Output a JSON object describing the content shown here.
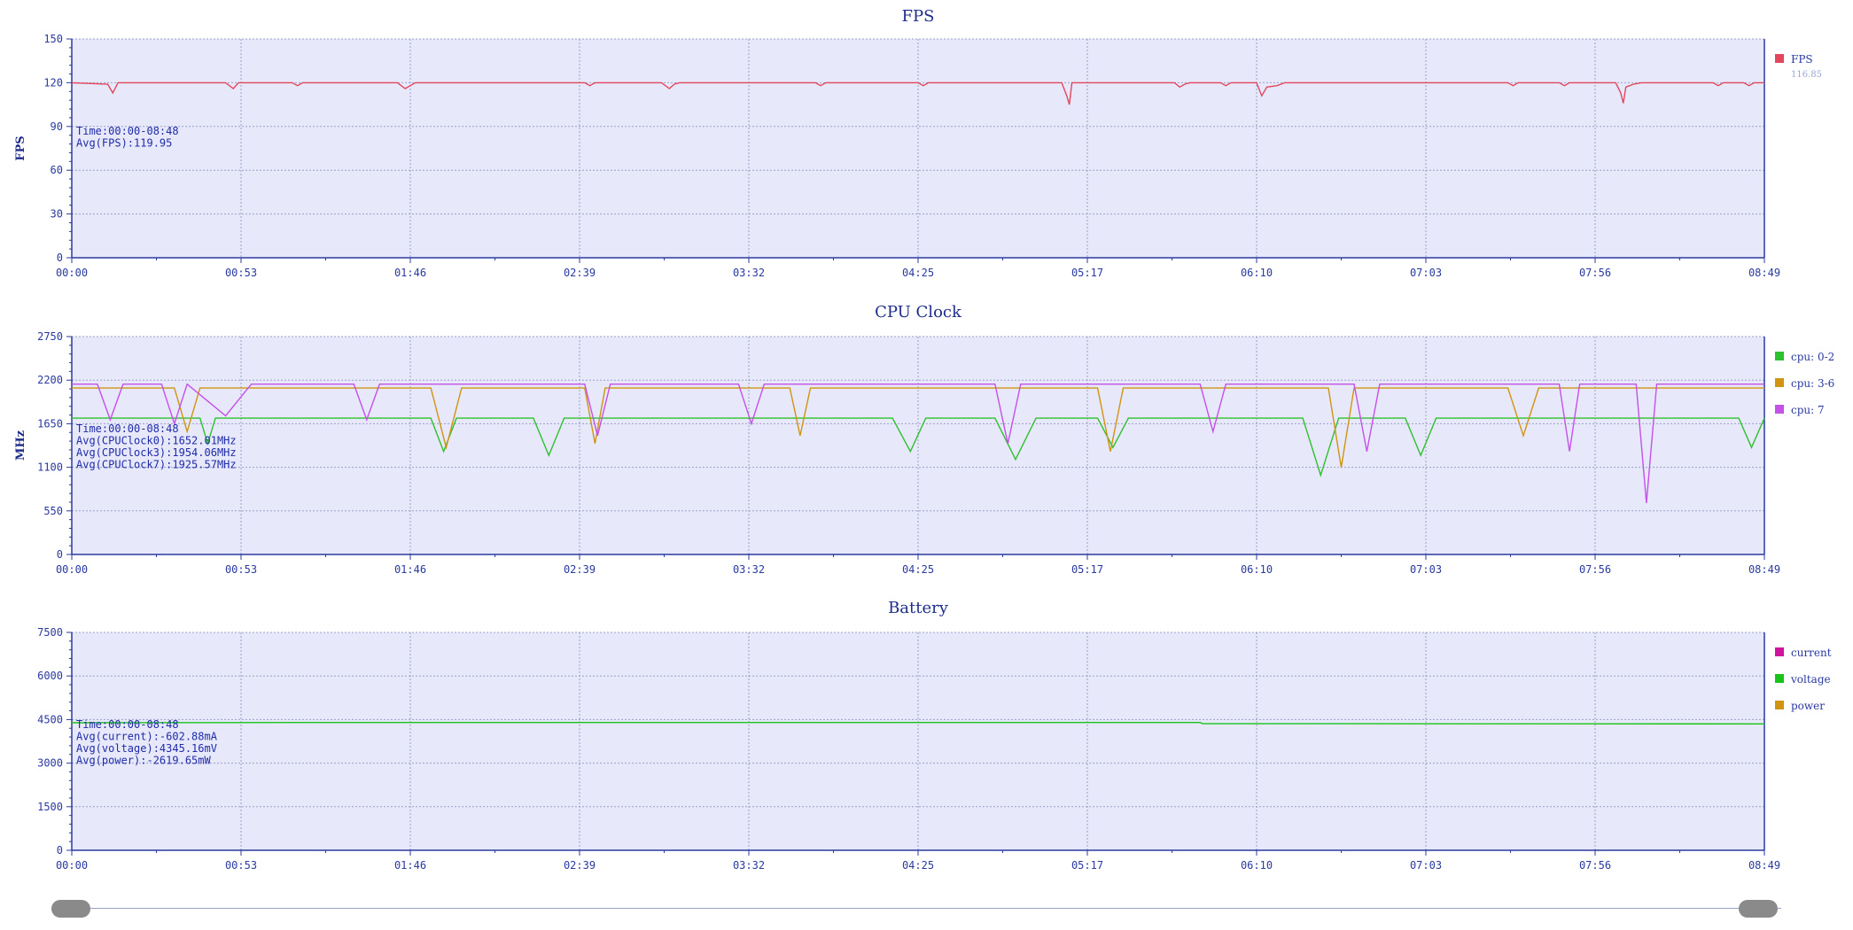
{
  "charts": [
    {
      "title": "FPS",
      "ylabel": "FPS",
      "ylim": [
        0,
        150
      ],
      "yticks": [
        "0",
        "30",
        "60",
        "90",
        "120",
        "150"
      ],
      "info": [
        "Time:00:00-08:48",
        "Avg(FPS):119.95"
      ],
      "legend": [
        {
          "name": "FPS",
          "color": "#e2475c",
          "sub": "116.85"
        }
      ]
    },
    {
      "title": "CPU Clock",
      "ylabel": "MHz",
      "ylim": [
        0,
        2750
      ],
      "yticks": [
        "0",
        "550",
        "1100",
        "1650",
        "2200",
        "2750"
      ],
      "info": [
        "Time:00:00-08:48",
        "Avg(CPUClock0):1652.01MHz",
        "Avg(CPUClock3):1954.06MHz",
        "Avg(CPUClock7):1925.57MHz"
      ],
      "legend": [
        {
          "name": "cpu: 0-2",
          "color": "#2ec12e"
        },
        {
          "name": "cpu: 3-6",
          "color": "#d09410"
        },
        {
          "name": "cpu: 7",
          "color": "#c451e8"
        }
      ]
    },
    {
      "title": "Battery",
      "ylabel": "",
      "ylim": [
        0,
        7500
      ],
      "yticks": [
        "0",
        "1500",
        "3000",
        "4500",
        "6000",
        "7500"
      ],
      "info": [
        "Time:00:00-08:48",
        "Avg(current):-602.88mA",
        "Avg(voltage):4345.16mV",
        "Avg(power):-2619.65mW"
      ],
      "legend": [
        {
          "name": "current",
          "color": "#d0149c"
        },
        {
          "name": "voltage",
          "color": "#17c417"
        },
        {
          "name": "power",
          "color": "#d09410"
        }
      ]
    }
  ],
  "xticks": [
    "00:00",
    "00:53",
    "01:46",
    "02:39",
    "03:32",
    "04:25",
    "05:17",
    "06:10",
    "07:03",
    "07:56",
    "08:49"
  ],
  "chart_data": [
    {
      "type": "line",
      "title": "FPS",
      "ylabel": "FPS",
      "ylim": [
        0,
        150
      ],
      "xlim": [
        "00:00",
        "08:49"
      ],
      "grid": true,
      "legend": "right",
      "series": [
        {
          "name": "FPS",
          "color": "#e2475c",
          "points": [
            [
              0,
              120
            ],
            [
              14,
              119
            ],
            [
              16,
              113
            ],
            [
              18,
              120
            ],
            [
              60,
              120
            ],
            [
              63,
              116
            ],
            [
              65,
              120
            ],
            [
              86,
              120
            ],
            [
              88,
              118
            ],
            [
              90,
              120
            ],
            [
              127,
              120
            ],
            [
              130,
              116
            ],
            [
              132,
              118
            ],
            [
              134,
              120
            ],
            [
              200,
              120
            ],
            [
              202,
              118
            ],
            [
              204,
              120
            ],
            [
              230,
              120
            ],
            [
              233,
              116
            ],
            [
              235,
              119
            ],
            [
              237,
              120
            ],
            [
              290,
              120
            ],
            [
              292,
              118
            ],
            [
              294,
              120
            ],
            [
              330,
              120
            ],
            [
              332,
              118
            ],
            [
              334,
              120
            ],
            [
              386,
              120
            ],
            [
              388,
              111
            ],
            [
              389,
              105
            ],
            [
              390,
              120
            ],
            [
              430,
              120
            ],
            [
              432,
              117
            ],
            [
              434,
              119
            ],
            [
              436,
              120
            ],
            [
              448,
              120
            ],
            [
              450,
              118
            ],
            [
              452,
              120
            ],
            [
              462,
              120
            ],
            [
              464,
              111
            ],
            [
              466,
              117
            ],
            [
              470,
              118
            ],
            [
              473,
              120
            ],
            [
              560,
              120
            ],
            [
              562,
              118
            ],
            [
              564,
              120
            ],
            [
              580,
              120
            ],
            [
              582,
              118
            ],
            [
              584,
              120
            ],
            [
              602,
              120
            ],
            [
              604,
              113
            ],
            [
              605,
              106
            ],
            [
              606,
              117
            ],
            [
              609,
              119
            ],
            [
              612,
              120
            ],
            [
              640,
              120
            ],
            [
              642,
              118
            ],
            [
              644,
              120
            ],
            [
              652,
              120
            ],
            [
              654,
              118
            ],
            [
              656,
              120
            ],
            [
              660,
              120
            ]
          ]
        }
      ]
    },
    {
      "type": "line",
      "title": "CPU Clock",
      "ylabel": "MHz",
      "ylim": [
        0,
        2750
      ],
      "xlim": [
        "00:00",
        "08:49"
      ],
      "grid": true,
      "legend": "right",
      "series": [
        {
          "name": "cpu: 0-2",
          "color": "#2ec12e",
          "points": [
            [
              0,
              1720
            ],
            [
              50,
              1720
            ],
            [
              53,
              1400
            ],
            [
              56,
              1720
            ],
            [
              140,
              1720
            ],
            [
              145,
              1300
            ],
            [
              150,
              1720
            ],
            [
              180,
              1720
            ],
            [
              186,
              1250
            ],
            [
              192,
              1720
            ],
            [
              320,
              1720
            ],
            [
              327,
              1300
            ],
            [
              333,
              1720
            ],
            [
              360,
              1720
            ],
            [
              368,
              1200
            ],
            [
              376,
              1720
            ],
            [
              400,
              1720
            ],
            [
              406,
              1350
            ],
            [
              412,
              1720
            ],
            [
              480,
              1720
            ],
            [
              487,
              1000
            ],
            [
              494,
              1720
            ],
            [
              520,
              1720
            ],
            [
              526,
              1250
            ],
            [
              532,
              1720
            ],
            [
              650,
              1720
            ],
            [
              655,
              1350
            ],
            [
              660,
              1720
            ]
          ]
        },
        {
          "name": "cpu: 3-6",
          "color": "#d09410",
          "points": [
            [
              0,
              2100
            ],
            [
              40,
              2100
            ],
            [
              45,
              1550
            ],
            [
              50,
              2100
            ],
            [
              140,
              2100
            ],
            [
              146,
              1350
            ],
            [
              152,
              2100
            ],
            [
              200,
              2100
            ],
            [
              204,
              1400
            ],
            [
              208,
              2100
            ],
            [
              280,
              2100
            ],
            [
              284,
              1500
            ],
            [
              288,
              2100
            ],
            [
              400,
              2100
            ],
            [
              405,
              1300
            ],
            [
              410,
              2100
            ],
            [
              490,
              2100
            ],
            [
              495,
              1100
            ],
            [
              500,
              2100
            ],
            [
              560,
              2100
            ],
            [
              566,
              1500
            ],
            [
              572,
              2100
            ],
            [
              660,
              2100
            ]
          ]
        },
        {
          "name": "cpu: 7",
          "color": "#c451e8",
          "points": [
            [
              0,
              2150
            ],
            [
              10,
              2150
            ],
            [
              15,
              1700
            ],
            [
              20,
              2150
            ],
            [
              35,
              2150
            ],
            [
              40,
              1650
            ],
            [
              45,
              2150
            ],
            [
              60,
              1750
            ],
            [
              70,
              2150
            ],
            [
              110,
              2150
            ],
            [
              115,
              1700
            ],
            [
              120,
              2150
            ],
            [
              200,
              2150
            ],
            [
              205,
              1500
            ],
            [
              210,
              2150
            ],
            [
              260,
              2150
            ],
            [
              265,
              1650
            ],
            [
              270,
              2150
            ],
            [
              360,
              2150
            ],
            [
              365,
              1400
            ],
            [
              370,
              2150
            ],
            [
              440,
              2150
            ],
            [
              445,
              1550
            ],
            [
              450,
              2150
            ],
            [
              500,
              2150
            ],
            [
              505,
              1300
            ],
            [
              510,
              2150
            ],
            [
              580,
              2150
            ],
            [
              584,
              1300
            ],
            [
              588,
              2150
            ],
            [
              610,
              2150
            ],
            [
              614,
              650
            ],
            [
              618,
              2150
            ],
            [
              660,
              2150
            ]
          ]
        }
      ]
    },
    {
      "type": "line",
      "title": "Battery",
      "ylim": [
        0,
        7500
      ],
      "xlim": [
        "00:00",
        "08:49"
      ],
      "grid": true,
      "legend": "right",
      "series": [
        {
          "name": "voltage",
          "color": "#17c417",
          "points": [
            [
              0,
              4390
            ],
            [
              89,
              4400
            ],
            [
              440,
              4400
            ],
            [
              441,
              4360
            ],
            [
              660,
              4350
            ]
          ]
        }
      ]
    }
  ],
  "slider": {
    "handle_color": "#8a8a8a"
  }
}
